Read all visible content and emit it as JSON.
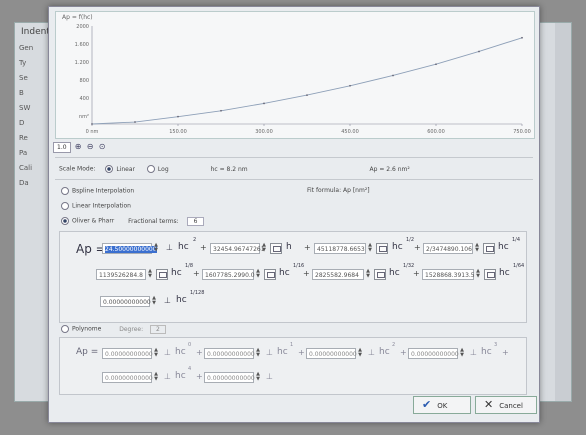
{
  "background_window": {
    "title": "Indenta",
    "side_labels": [
      "Gen",
      "Ty",
      "Se",
      "B",
      "SW",
      "D",
      "Re",
      "Pa",
      "Cali",
      "Da"
    ]
  },
  "plot": {
    "title": "Ap = f(hc)",
    "y_ticks": [
      "2000",
      "1.600",
      "1.200",
      "800",
      "400",
      "nm²"
    ],
    "x_ticks": [
      "0  nm",
      "150.00",
      "300.00",
      "450.00",
      "600.00",
      "750.00"
    ],
    "accent": "#8ea0b8"
  },
  "chart_data": {
    "type": "line",
    "title": "Ap = f(hc)",
    "xlim": [
      0,
      750
    ],
    "ylim": [
      0,
      2000
    ],
    "x": [
      0,
      75,
      150,
      225,
      300,
      375,
      450,
      525,
      600,
      675,
      750
    ],
    "y": [
      0,
      40,
      150,
      270,
      420,
      590,
      780,
      990,
      1220,
      1480,
      1760
    ]
  },
  "toolbar": {
    "zoom_select": "1.0",
    "icons": [
      "zoom-in-icon",
      "zoom-out-icon",
      "zoom-reset-icon"
    ]
  },
  "scale": {
    "label": "Scale Mode:",
    "linear": "Linear",
    "log": "Log",
    "hc_text": "hc = 8.2 nm",
    "ap_text": "Ap = 2.6 nm²"
  },
  "interp": {
    "bspline": "Bspline Interpolation",
    "fit_formula": "Fit formula: Ap [nm²]",
    "linear": "Linear Interpolation",
    "oliver": "Oliver & Pharr",
    "fractional_label": "Fractional terms:",
    "fractional_value": "6"
  },
  "formula": {
    "ap_label": "Ap =",
    "c0": "24.50000000000",
    "c1": "32454.96747261",
    "c2": "45118778.6653",
    "c3": "2/3474890.106",
    "c4": "1139526284.8",
    "c5": "1607785.2990.0",
    "c6": "2825582.9684",
    "c7": "1528868.3913.5",
    "c8": "0.00000000000",
    "hc": "hc",
    "h": "h",
    "exps": [
      "2",
      "1/2",
      "1/4",
      "1/8",
      "1/16",
      "1/32",
      "1/64",
      "1/128"
    ]
  },
  "polynome": {
    "label": "Polynome",
    "degree_label": "Degree:",
    "degree_value": "2",
    "ap_label": "Ap =",
    "coeffs": [
      "0.00000000000",
      "0.00000000000",
      "0.00000000000",
      "0.00000000000",
      "0.00000000000",
      "0.00000000000"
    ],
    "hc": "hc",
    "exps": [
      "0",
      "1",
      "2",
      "3",
      "4"
    ]
  },
  "buttons": {
    "ok": "OK",
    "cancel": "Cancel"
  }
}
